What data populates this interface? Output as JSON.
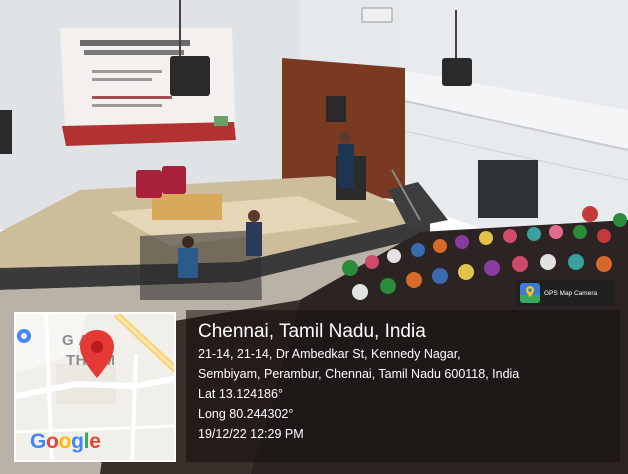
{
  "photo": {
    "description_scene": "auditorium",
    "colors": {
      "ceiling": "#e9ecef",
      "wall": "#d8dde0",
      "stage_floor": "#c9b896",
      "wood_panel": "#7a3a22",
      "screen": "#f2efec",
      "screen_band": "#b03030",
      "audience_dark": "#2a2220",
      "floor": "#bdb7ad"
    }
  },
  "map": {
    "label_line1": "G    AM",
    "label_line2": "TH    AM",
    "google_letters": [
      {
        "ch": "G",
        "color": "#4285F4"
      },
      {
        "ch": "o",
        "color": "#EA4335"
      },
      {
        "ch": "o",
        "color": "#FBBC05"
      },
      {
        "ch": "g",
        "color": "#4285F4"
      },
      {
        "ch": "l",
        "color": "#34A853"
      },
      {
        "ch": "e",
        "color": "#EA4335"
      }
    ],
    "pin_color": "#e53935"
  },
  "gps_badge": {
    "text": "GPS Map Camera",
    "icon": "gps-map-camera-icon"
  },
  "info": {
    "title": "Chennai, Tamil Nadu, India",
    "address_line1": "21-14, 21-14, Dr Ambedkar St, Kennedy Nagar,",
    "address_line2": "Sembiyam, Perambur, Chennai, Tamil Nadu 600118, India",
    "lat": "Lat 13.124186°",
    "long": "Long 80.244302°",
    "datetime": "19/12/22 12:29 PM"
  }
}
